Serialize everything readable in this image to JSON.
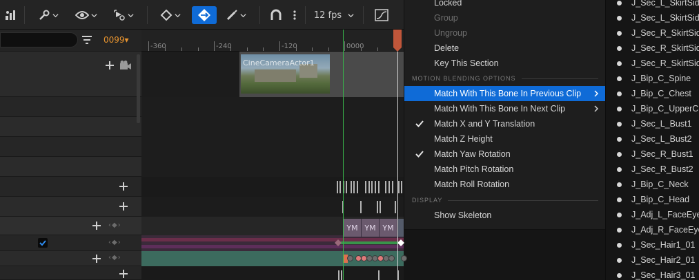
{
  "toolbar": {
    "fps_label": "12 fps",
    "icons": [
      "skeleton-tree-icon",
      "wrench-icon",
      "eye-icon",
      "keyframe-auto-icon",
      "diamond-key-icon",
      "snap-active-icon",
      "brush-icon",
      "magnet-icon",
      "more-vertical-icon",
      "curve-editor-icon"
    ]
  },
  "outliner": {
    "frame_display": "0099▾"
  },
  "ruler": {
    "labels": [
      "-360",
      "-240",
      "-120",
      "0000"
    ]
  },
  "timeline": {
    "camera_clip_label": "CineCameraActor1",
    "section_labels": [
      "YM",
      "YM",
      "YM"
    ]
  },
  "menu": {
    "items_top": [
      "Locked",
      "Group",
      "Ungroup",
      "Delete",
      "Key This Section"
    ],
    "section_motion": "MOTION BLENDING OPTIONS",
    "motion_items": [
      "Match With This Bone In Previous Clip",
      "Match With This Bone In Next Clip",
      "Match X and Y Translation",
      "Match Z Height",
      "Match Yaw Rotation",
      "Match Pitch Rotation",
      "Match Roll Rotation"
    ],
    "section_display": "DISPLAY",
    "display_items": [
      "Show Skeleton"
    ]
  },
  "bones": [
    "J_Sec_L_SkirtSide",
    "J_Sec_L_SkirtSide",
    "J_Sec_R_SkirtSide",
    "J_Sec_R_SkirtSide",
    "J_Sec_R_SkirtSide",
    "J_Bip_C_Spine",
    "J_Bip_C_Chest",
    "J_Bip_C_UpperChest",
    "J_Sec_L_Bust1",
    "J_Sec_L_Bust2",
    "J_Sec_R_Bust1",
    "J_Sec_R_Bust2",
    "J_Bip_C_Neck",
    "J_Bip_C_Head",
    "J_Adj_L_FaceEye",
    "J_Adj_R_FaceEye",
    "J_Sec_Hair1_01",
    "J_Sec_Hair2_01",
    "J_Sec_Hair3_01"
  ],
  "colors": {
    "accent": "#0f6bd7",
    "frame_orange": "#e8942f",
    "playhead_green": "#38b24a",
    "section_purple": "#6b5a6e",
    "track_teal": "#3c6b5e"
  }
}
